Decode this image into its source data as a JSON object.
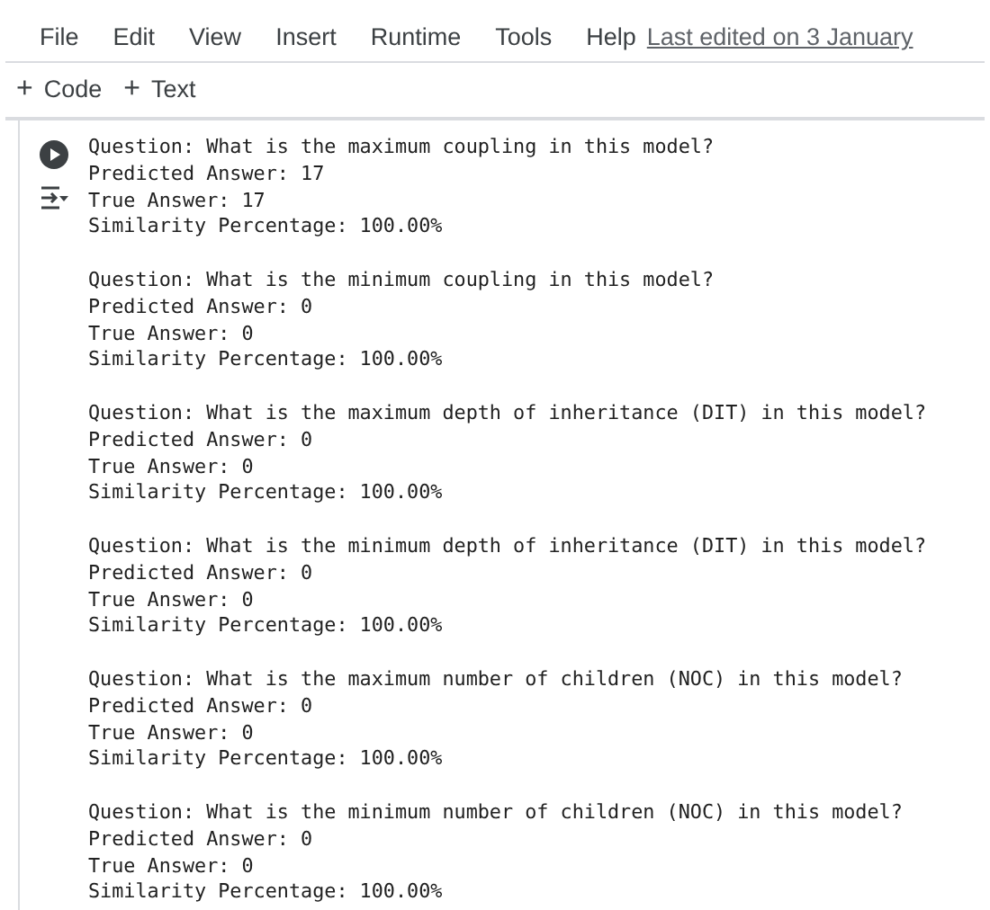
{
  "menu": {
    "items": [
      "File",
      "Edit",
      "View",
      "Insert",
      "Runtime",
      "Tools",
      "Help"
    ],
    "last_edited": "Last edited on 3 January"
  },
  "toolbar": {
    "buttons": [
      {
        "icon": "+",
        "label": "Code"
      },
      {
        "icon": "+",
        "label": "Text"
      }
    ]
  },
  "output": {
    "blocks": [
      [
        "Question: What is the maximum coupling in this model?",
        "Predicted Answer: 17",
        "True Answer: 17",
        "Similarity Percentage: 100.00%"
      ],
      [
        "Question: What is the minimum coupling in this model?",
        "Predicted Answer: 0",
        "True Answer: 0",
        "Similarity Percentage: 100.00%"
      ],
      [
        "Question: What is the maximum depth of inheritance (DIT) in this model?",
        "Predicted Answer: 0",
        "True Answer: 0",
        "Similarity Percentage: 100.00%"
      ],
      [
        "Question: What is the minimum depth of inheritance (DIT) in this model?",
        "Predicted Answer: 0",
        "True Answer: 0",
        "Similarity Percentage: 100.00%"
      ],
      [
        "Question: What is the maximum number of children (NOC) in this model?",
        "Predicted Answer: 0",
        "True Answer: 0",
        "Similarity Percentage: 100.00%"
      ],
      [
        "Question: What is the minimum number of children (NOC) in this model?",
        "Predicted Answer: 0",
        "True Answer: 0",
        "Similarity Percentage: 100.00%"
      ]
    ]
  }
}
